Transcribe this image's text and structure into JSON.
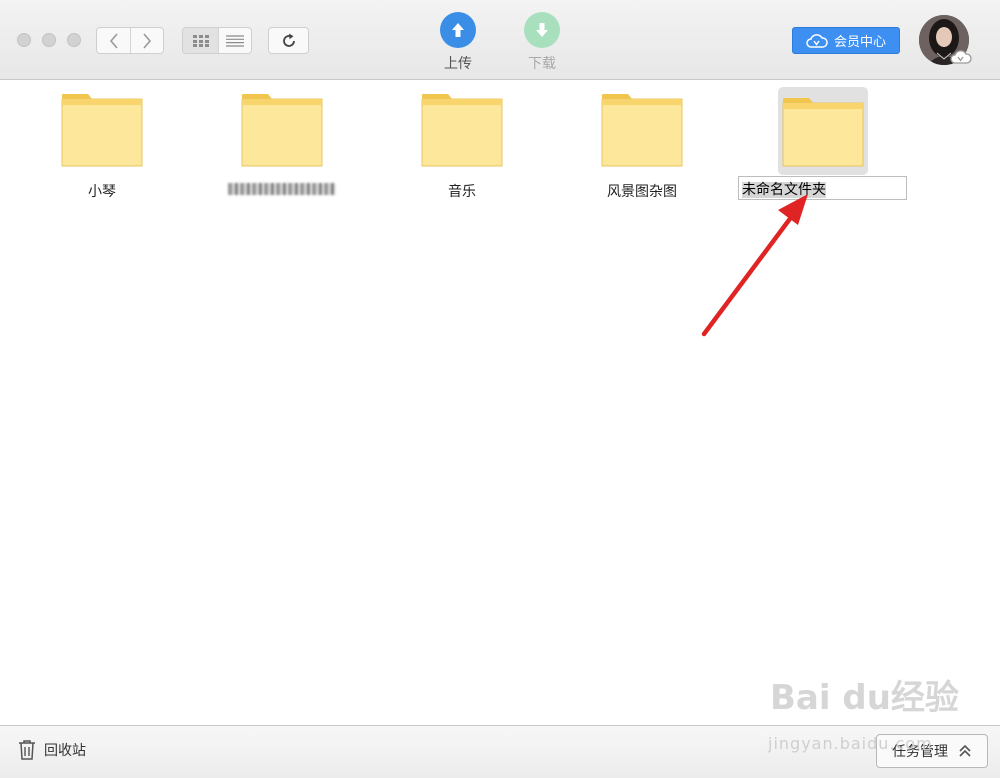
{
  "toolbar": {
    "upload_label": "上传",
    "download_label": "下载",
    "vip_label": "会员中心",
    "colors": {
      "upload": "#3a8ee6",
      "download": "#a8e0bd",
      "vip": "#3d8ff1"
    },
    "icons": {
      "back": "chevron-left-icon",
      "forward": "chevron-right-icon",
      "grid": "grid-view-icon",
      "list": "list-view-icon",
      "refresh": "refresh-icon",
      "upload": "arrow-up-icon",
      "download": "arrow-down-icon"
    }
  },
  "folders": [
    {
      "name": "小琴"
    },
    {
      "name": ""
    },
    {
      "name": "音乐"
    },
    {
      "name": "风景图杂图"
    }
  ],
  "rename": {
    "value": "未命名文件夹"
  },
  "bottom": {
    "trash_label": "回收站",
    "tasks_label": "任务管理"
  },
  "watermark": {
    "brand": "Bai du经验",
    "url": "jingyan.baidu.com"
  }
}
